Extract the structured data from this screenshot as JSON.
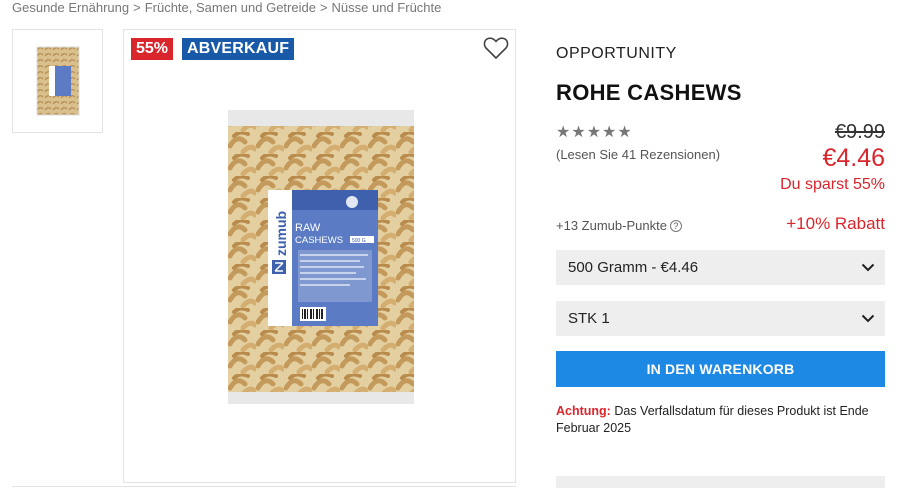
{
  "breadcrumb": [
    "Gesunde Ernährung",
    "Früchte, Samen und Getreide",
    "Nüsse und Früchte"
  ],
  "badges": {
    "discount": "55%",
    "sale": "ABVERKAUF"
  },
  "packaging": {
    "brand": "zumub",
    "product_line1": "RAW",
    "product_line2": "CASHEWS",
    "weight": "500 G"
  },
  "product": {
    "brand": "OPPORTUNITY",
    "title": "ROHE CASHEWS",
    "rating": 0,
    "reviews_text": "(Lesen Sie 41 Rezensionen)",
    "old_price": "€9.99",
    "new_price": "€4.46",
    "savings": "Du sparst 55%",
    "points": "+13 Zumub-Punkte",
    "extra_discount": "+10% Rabatt"
  },
  "options": {
    "size": "500 Gramm - €4.46",
    "quantity": "STK 1"
  },
  "cart_button": "IN DEN WARENKORB",
  "notice": {
    "label": "Achtung:",
    "text": "Das Verfallsdatum für dieses Produkt ist Ende Februar 2025"
  },
  "colors": {
    "accent_red": "#d9262c",
    "badge_blue": "#1859a8",
    "button_blue": "#1e88e5"
  }
}
